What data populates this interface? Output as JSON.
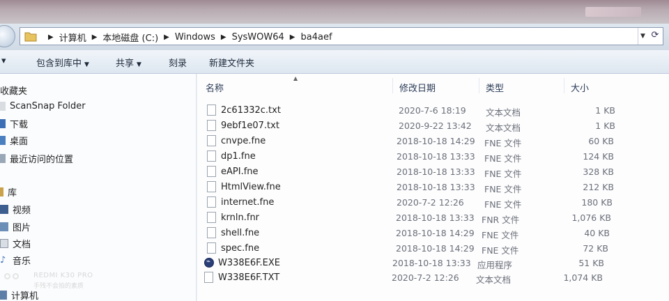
{
  "address": {
    "crumbs": [
      "计算机",
      "本地磁盘 (C:)",
      "Windows",
      "SysWOW64",
      "ba4aef"
    ]
  },
  "toolbar": {
    "include_library": "包含到库中",
    "share": "共享",
    "burn": "刻录",
    "new_folder": "新建文件夹"
  },
  "nav": {
    "favorites": "收藏夹",
    "scansnap": "ScanSnap Folder",
    "downloads": "下载",
    "desktop": "桌面",
    "recent": "最近访问的位置",
    "libraries": "库",
    "videos": "视频",
    "pictures": "图片",
    "documents": "文档",
    "music": "音乐",
    "computer": "计算机"
  },
  "columns": {
    "name": "名称",
    "modified": "修改日期",
    "type": "类型",
    "size": "大小"
  },
  "files": [
    {
      "name": "2c61332c.txt",
      "modified": "2020-7-6 18:19",
      "type": "文本文档",
      "size": "1 KB",
      "icon": "text-file-icon"
    },
    {
      "name": "9ebf1e07.txt",
      "modified": "2020-9-22 13:42",
      "type": "文本文档",
      "size": "1 KB",
      "icon": "text-file-icon"
    },
    {
      "name": "cnvpe.fne",
      "modified": "2018-10-18 14:29",
      "type": "FNE 文件",
      "size": "60 KB",
      "icon": "file-icon"
    },
    {
      "name": "dp1.fne",
      "modified": "2018-10-18 13:33",
      "type": "FNE 文件",
      "size": "124 KB",
      "icon": "file-icon"
    },
    {
      "name": "eAPI.fne",
      "modified": "2018-10-18 13:33",
      "type": "FNE 文件",
      "size": "328 KB",
      "icon": "file-icon"
    },
    {
      "name": "HtmlView.fne",
      "modified": "2018-10-18 13:33",
      "type": "FNE 文件",
      "size": "212 KB",
      "icon": "file-icon"
    },
    {
      "name": "internet.fne",
      "modified": "2020-7-2 12:26",
      "type": "FNE 文件",
      "size": "180 KB",
      "icon": "file-icon"
    },
    {
      "name": "krnln.fnr",
      "modified": "2018-10-18 13:33",
      "type": "FNR 文件",
      "size": "1,076 KB",
      "icon": "file-icon"
    },
    {
      "name": "shell.fne",
      "modified": "2018-10-18 14:29",
      "type": "FNE 文件",
      "size": "40 KB",
      "icon": "file-icon"
    },
    {
      "name": "spec.fne",
      "modified": "2018-10-18 14:29",
      "type": "FNE 文件",
      "size": "72 KB",
      "icon": "file-icon"
    },
    {
      "name": "W338E6F.EXE",
      "modified": "2018-10-18 13:33",
      "type": "应用程序",
      "size": "51 KB",
      "icon": "exe-app-icon"
    },
    {
      "name": "W338E6F.TXT",
      "modified": "2020-7-2 12:26",
      "type": "文本文档",
      "size": "1,074 KB",
      "icon": "text-file-icon"
    }
  ],
  "watermark": {
    "line1": "REDMI K30 PRO",
    "line2": "手残不会拍的素质"
  }
}
